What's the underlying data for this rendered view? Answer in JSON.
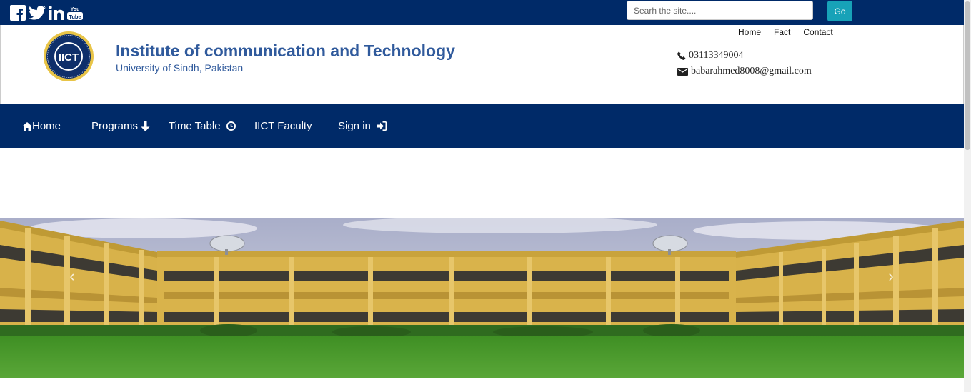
{
  "topbar": {
    "social_icons": [
      "facebook-icon",
      "twitter-icon",
      "linkedin-icon",
      "youtube-icon"
    ],
    "youtube_icon_text": {
      "top": "You",
      "bottom": "Tube"
    },
    "search_placeholder": "Searh the site....",
    "go_label": "Go"
  },
  "header": {
    "logo_text": "IICT",
    "title": "Institute of communication and Technology",
    "subtitle": "University of Sindh, Pakistan",
    "links": [
      "Home",
      "Fact",
      "Contact"
    ],
    "phone": "03113349004",
    "email": "babarahmed8008@gmail.com"
  },
  "nav": {
    "items": [
      {
        "label": "Home",
        "icon": "home-icon"
      },
      {
        "label": "Programs",
        "icon": "arrow-down-icon"
      },
      {
        "label": "Time Table",
        "icon": "clock-icon"
      },
      {
        "label": "IICT Faculty",
        "icon": ""
      },
      {
        "label": "Sign in",
        "icon": "sign-in-icon"
      }
    ]
  },
  "carousel": {
    "prev_glyph": "‹",
    "next_glyph": "›"
  },
  "colors": {
    "navy": "#002a68",
    "title_blue": "#305a9c",
    "go_button": "#17a2b8",
    "building_yellow": "#d8b24a",
    "lawn_green": "#4f9a2c"
  }
}
